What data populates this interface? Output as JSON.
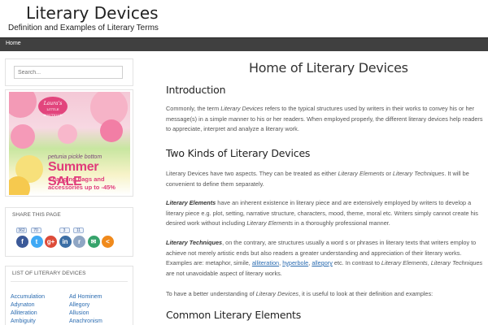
{
  "site": {
    "title": "Literary Devices",
    "tagline": "Definition and Examples of Literary Terms"
  },
  "nav": {
    "home": "Home"
  },
  "search": {
    "placeholder": "Search..."
  },
  "ad": {
    "logo_line1": "Laura's",
    "logo_line2": "LITTLE BOUTIQUE",
    "brand": "petunia pickle bottom",
    "headline": "Summer SALE",
    "line1": "Changing bags and",
    "line2": "accessories up to -45%"
  },
  "share": {
    "title": "SHARE THIS PAGE",
    "buttons": [
      {
        "icon": "facebook-icon",
        "count": "362",
        "glyph": "f",
        "color": "#3b5998"
      },
      {
        "icon": "twitter-icon",
        "count": "70",
        "glyph": "t",
        "color": "#3fa9f5"
      },
      {
        "icon": "google-plus-icon",
        "count": "",
        "glyph": "g+",
        "color": "#dd4b39"
      },
      {
        "icon": "linkedin-icon",
        "count": "3",
        "glyph": "in",
        "color": "#3b6ea5"
      },
      {
        "icon": "reddit-icon",
        "count": "11",
        "glyph": "r",
        "color": "#8fa6c4"
      },
      {
        "icon": "email-icon",
        "count": "",
        "glyph": "✉",
        "color": "#36a36b"
      },
      {
        "icon": "share-icon",
        "count": "",
        "glyph": "<",
        "color": "#f08a1c"
      }
    ]
  },
  "list": {
    "title": "LIST OF LITERARY DEVICES",
    "col1": [
      "Accumulation",
      "Adynaton",
      "Alliteration",
      "Ambiguity"
    ],
    "col2": [
      "Ad Hominem",
      "Allegory",
      "Allusion",
      "Anachronism"
    ]
  },
  "main": {
    "page_title": "Home of Literary Devices",
    "h_intro": "Introduction",
    "intro_1": "Commonly, the term ",
    "intro_term": "Literary Devices",
    "intro_2": " refers to the typical structures used by writers in their works to convey his or her message(s) in a simple manner to his or her readers.  When employed properly, the different literary devices help readers to appreciate, interpret and analyze a literary work.",
    "h_two": "Two Kinds of Literary Devices",
    "two_1": "Literary Devices have two aspects. They can be treated as either ",
    "two_elements": "Literary Elements",
    "two_or": " or ",
    "two_techniques": "Literary Techniques",
    "two_2": ". It will be convenient to define them separately.",
    "el_term": "Literary Elements",
    "el_text": " have an inherent existence in literary piece and are extensively employed by writers to develop a literary piece e.g. plot, setting, narrative structure, characters, mood, theme, moral etc. Writers simply cannot create his desired work without including ",
    "el_term2": "Literary Elements",
    "el_end": " in a thoroughly professional manner.",
    "tech_term": "Literary Techniques",
    "tech_text": ", on the contrary, are structures usually a word s or phrases in literary texts that writers employ to achieve not merely artistic ends but also readers a greater understanding and appreciation of their literary works. Examples are:  metaphor, simile, ",
    "link_alliteration": "alliteration",
    "link_hyperbole": "hyperbole",
    "link_allegory": "allegory",
    "tech_mid": " etc. In contrast to ",
    "tech_term2": "Literary Elements",
    "tech_comma": ", ",
    "tech_term3": "Literary Techniques",
    "tech_end": " are not unavoidable aspect of literary works.",
    "better_1": "To have a better understanding of ",
    "better_term": "Literary Devices",
    "better_2": ", it is useful to look at their definition and examples:",
    "h_common": "Common Literary Elements"
  }
}
